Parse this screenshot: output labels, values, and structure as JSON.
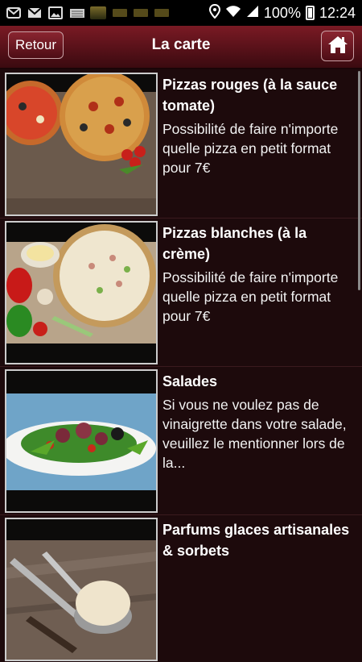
{
  "status_bar": {
    "battery": "100%",
    "time": "12:24"
  },
  "action_bar": {
    "back_label": "Retour",
    "title": "La carte"
  },
  "items": [
    {
      "title": "Pizzas rouges (à la sauce tomate)",
      "description": "Possibilité de faire n'importe quelle pizza en petit format pour 7€"
    },
    {
      "title": "Pizzas blanches (à la crème)",
      "description": "Possibilité de faire n'importe quelle pizza en petit format pour 7€"
    },
    {
      "title": "Salades",
      "description": "Si vous ne voulez pas de vinaigrette dans votre salade, veuillez le mentionner lors de la..."
    },
    {
      "title": "Parfums glaces artisanales & sorbets",
      "description": ""
    }
  ]
}
